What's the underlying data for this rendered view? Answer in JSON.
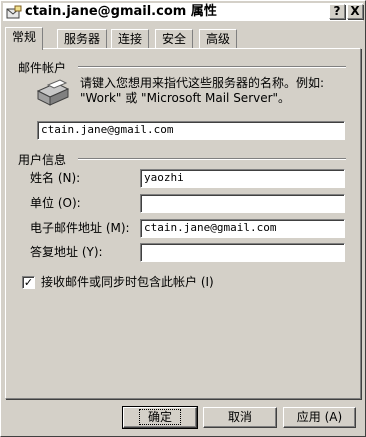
{
  "window": {
    "title": "ctain.jane@gmail.com 属性",
    "help_button": "?",
    "close_button": "X"
  },
  "tabs": [
    {
      "label": "常规",
      "active": true
    },
    {
      "label": "服务器"
    },
    {
      "label": "连接"
    },
    {
      "label": "安全"
    },
    {
      "label": "高级"
    }
  ],
  "mail_account": {
    "group_label": "邮件帐户",
    "description_line1": "请键入您想用来指代这些服务器的名称。例如:",
    "description_line2": "\"Work\" 或 \"Microsoft Mail Server\"。",
    "account_name": "ctain.jane@gmail.com"
  },
  "user_info": {
    "group_label": "用户信息",
    "name_label": "姓名 (N):",
    "name_value": "yaozhi",
    "org_label": "单位 (O):",
    "org_value": "",
    "email_label": "电子邮件地址 (M):",
    "email_value": "ctain.jane@gmail.com",
    "reply_label": "答复地址 (Y):",
    "reply_value": ""
  },
  "include_account": {
    "label": "接收邮件或同步时包含此帐户 (I)",
    "checked": true,
    "mark": "✓"
  },
  "buttons": {
    "ok": "确定",
    "cancel": "取消",
    "apply": "应用 (A)"
  },
  "colors": {
    "face": "#d4d0c8",
    "shadow": "#808080",
    "highlight": "#ffffff"
  }
}
